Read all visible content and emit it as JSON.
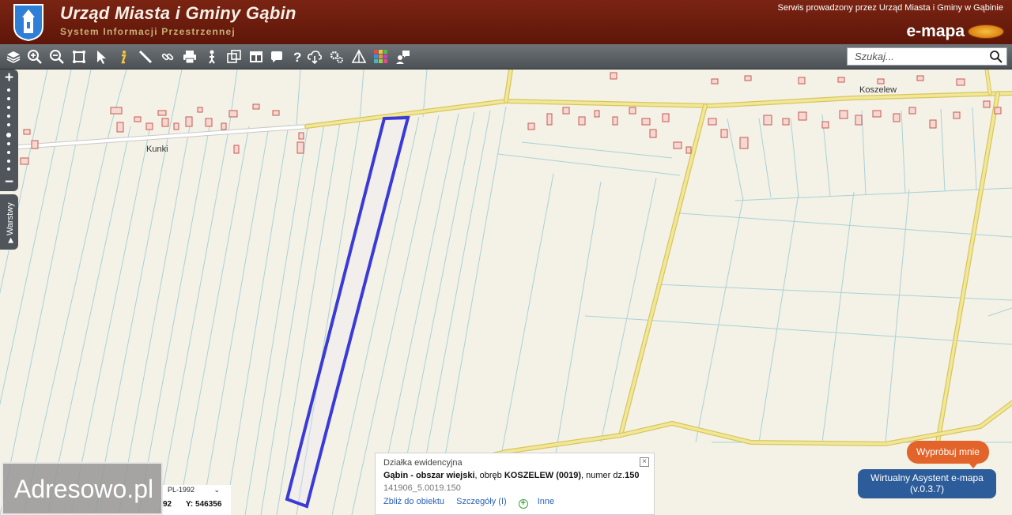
{
  "header": {
    "title": "Urząd Miasta i Gminy Gąbin",
    "subtitle": "System Informacji Przestrzennej",
    "service_text": "Serwis prowadzony przez Urząd Miasta i Gminy w Gąbinie",
    "emapa_label": "e-mapa"
  },
  "toolbar": {
    "tools": [
      "layers-icon",
      "zoom-in-icon",
      "zoom-out-icon",
      "zoom-extent-icon",
      "select-arrow-icon",
      "info-icon",
      "measure-ruler-icon",
      "link-icon",
      "print-icon",
      "person-marker-icon",
      "copy-icon",
      "window-layout-icon",
      "speech-bubble-icon",
      "help-icon",
      "cloud-download-icon",
      "settings-gears-icon",
      "triangle-pyramid-icon",
      "color-grid-icon",
      "comment-user-icon"
    ],
    "search_placeholder": "Szukaj..."
  },
  "map": {
    "labels": {
      "kunki": "Kunki",
      "koszelew": "Koszelew"
    },
    "layers_tab_label": "Warstwy"
  },
  "watermark": "Adresowo.pl",
  "coords": {
    "crs": "PL-1992",
    "x_value": "92",
    "y_label": "Y: 546356"
  },
  "popup": {
    "title": "Działka ewidencyjna",
    "line1_bold1": "Gąbin - obszar wiejski",
    "line1_text1": ", obręb ",
    "line1_bold2": "KOSZELEW (0019)",
    "line1_text2": ", numer dz.",
    "line1_bold3": "150",
    "line2": "141906_5.0019.150",
    "link_zoom": "Zbliż do obiektu",
    "link_details": "Szczegóły (I)",
    "link_other": "Inne"
  },
  "assistant": {
    "try_label": "Wypróbuj mnie",
    "line1": "Wirtualny Asystent e-mapa",
    "line2": "(v.0.3.7)"
  },
  "colors": {
    "header_bg": "#6e1d0e",
    "parcel_highlight": "#3a3ad8",
    "road": "#e8d88a"
  }
}
